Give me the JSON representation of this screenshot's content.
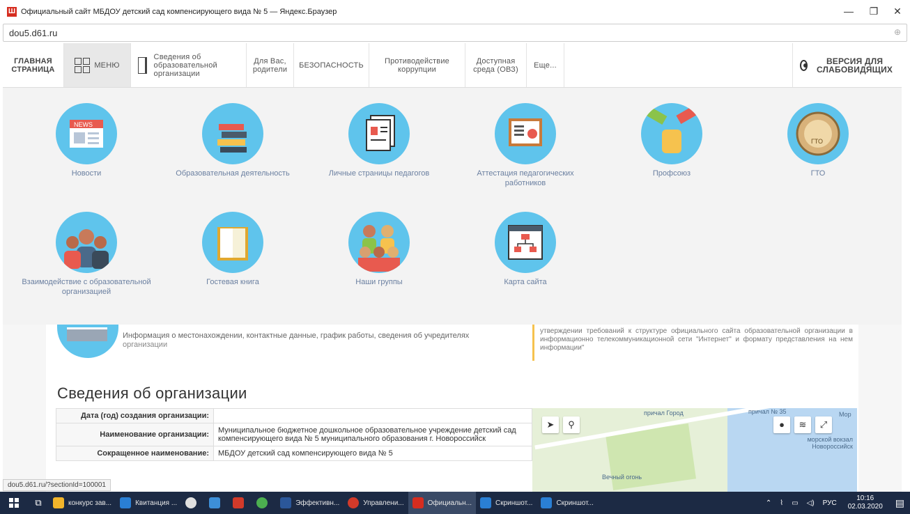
{
  "window": {
    "title": "Официальный сайт МБДОУ детский сад компенсирующего вида № 5 — Яндекс.Браузер",
    "minimize": "—",
    "maximize": "❐",
    "close": "✕"
  },
  "address": {
    "url": "dou5.d61.ru"
  },
  "nav": {
    "home": "ГЛАВНАЯ СТРАНИЦА",
    "menu": "МЕНЮ",
    "info": "Сведения об образовательной организации",
    "parents": "Для Вас, родители",
    "safety": "БЕЗОПАСНОСТЬ",
    "corruption": "Противодействие коррупции",
    "access": "Доступная среда (ОВЗ)",
    "more": "Еще...",
    "vision": "ВЕРСИЯ ДЛЯ СЛАБОВИДЯЩИХ"
  },
  "menu_tiles": [
    {
      "label": "Новости",
      "icon": "news-icon"
    },
    {
      "label": "Образовательная деятельность",
      "icon": "books-icon"
    },
    {
      "label": "Личные страницы педагогов",
      "icon": "profile-pages-icon"
    },
    {
      "label": "Аттестация педагогических работников",
      "icon": "certificate-icon"
    },
    {
      "label": "Профсоюз",
      "icon": "union-hands-icon"
    },
    {
      "label": "ГТО",
      "icon": "gto-badge-icon"
    },
    {
      "label": "Взаимодействие с образовательной организацией",
      "icon": "people-icon"
    },
    {
      "label": "Гостевая книга",
      "icon": "guestbook-icon"
    },
    {
      "label": "Наши группы",
      "icon": "children-icon"
    },
    {
      "label": "Карта сайта",
      "icon": "sitemap-icon"
    }
  ],
  "main": {
    "info_text": "Информация о местонахождении, контактные данные, график работы, сведения об учредителях",
    "info_sub": "организации",
    "note": "утверждении требований к структуре официального сайта образовательной организации в информационно телекоммуникационной сети \"Интернет\" и формату представления на нем информации\"",
    "heading": "Сведения об организации",
    "table": [
      {
        "key": "Дата (год) создания организации:",
        "value": ""
      },
      {
        "key": "Наименование организации:",
        "value": "Муниципальное бюджетное дошкольное образовательное учреждение детский сад компенсирующего вида № 5 муниципального образования г. Новороссийск"
      },
      {
        "key": "Сокращенное наименование:",
        "value": "МБДОУ детский сад компенсирующего вида № 5"
      }
    ],
    "map_labels": {
      "a": "причал Город",
      "b": "причал № 35",
      "c": "Мор",
      "d": "морской вокзал Новороссийск",
      "e": "Вечный огонь"
    }
  },
  "status_url": "dou5.d61.ru/?sectionId=100001",
  "taskbar": {
    "apps": [
      {
        "label": "конкурс зав...",
        "color": "#f2b52b"
      },
      {
        "label": "Квитанция ...",
        "color": "#2a7fd4"
      },
      {
        "label": "",
        "color": "#e0e0e0"
      },
      {
        "label": "",
        "color": "#3d8fd8"
      },
      {
        "label": "",
        "color": "#d23a2a"
      },
      {
        "label": "",
        "color": "#4caf50"
      },
      {
        "label": "Эффективн...",
        "color": "#2b579a"
      },
      {
        "label": "Управлени...",
        "color": "#d23a2a"
      },
      {
        "label": "Официальн...",
        "color": "#d62d20"
      },
      {
        "label": "Скриншот...",
        "color": "#2a7fd4"
      },
      {
        "label": "Скриншот...",
        "color": "#2a7fd4"
      }
    ],
    "lang": "РУС",
    "time": "10:16",
    "date": "02.03.2020"
  }
}
